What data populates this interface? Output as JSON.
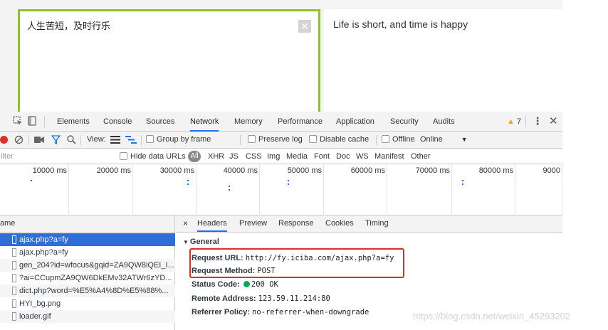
{
  "translator": {
    "source_text": "人生苦短，及时行乐",
    "clear_icon": "close-icon",
    "translation": "Life is short, and time is happy",
    "accent_color": "#8dc21f"
  },
  "devtools": {
    "tabs": [
      {
        "label": "Elements",
        "active": false
      },
      {
        "label": "Console",
        "active": false
      },
      {
        "label": "Sources",
        "active": false
      },
      {
        "label": "Network",
        "active": true
      },
      {
        "label": "Memory",
        "active": false
      },
      {
        "label": "Performance",
        "active": false
      },
      {
        "label": "Application",
        "active": false
      },
      {
        "label": "Security",
        "active": false
      },
      {
        "label": "Audits",
        "active": false
      }
    ],
    "warning_count": "7",
    "toolbar": {
      "view_label": "View:",
      "group_by_frame": "Group by frame",
      "preserve_log": "Preserve log",
      "disable_cache": "Disable cache",
      "offline": "Offline",
      "throttle": "Online"
    },
    "filter": {
      "placeholder": "ilter",
      "hide_data_urls": "Hide data URLs",
      "types": [
        "All",
        "XHR",
        "JS",
        "CSS",
        "Img",
        "Media",
        "Font",
        "Doc",
        "WS",
        "Manifest",
        "Other"
      ]
    },
    "timeline_ticks": [
      "10000 ms",
      "20000 ms",
      "30000 ms",
      "40000 ms",
      "50000 ms",
      "60000 ms",
      "70000 ms",
      "80000 ms",
      "9000"
    ],
    "name_header": "ame",
    "requests": [
      "ajax.php?a=fy",
      "ajax.php?a=fy",
      "gen_204?id=wfocus&gqid=ZA9QW8iQEI_I...",
      "?ai=CCupmZA9QW6DkEMv32ATWr6zYD...",
      "dict.php?word=%E5%A4%8D%E5%88%...",
      "HYI_bg.png",
      "loader.gif"
    ],
    "detail_tabs": [
      {
        "label": "Headers",
        "active": true
      },
      {
        "label": "Preview",
        "active": false
      },
      {
        "label": "Response",
        "active": false
      },
      {
        "label": "Cookies",
        "active": false
      },
      {
        "label": "Timing",
        "active": false
      }
    ],
    "general": {
      "title": "General",
      "request_url_label": "Request URL:",
      "request_url": "http://fy.iciba.com/ajax.php?a=fy",
      "request_method_label": "Request Method:",
      "request_method": "POST",
      "status_code_label": "Status Code:",
      "status_code": "200 OK",
      "remote_address_label": "Remote Address:",
      "remote_address": "123.59.11.214:80",
      "referrer_policy_label": "Referrer Policy:",
      "referrer_policy": "no-referrer-when-downgrade"
    }
  },
  "watermark": "https://blog.csdn.net/weixin_45293202"
}
